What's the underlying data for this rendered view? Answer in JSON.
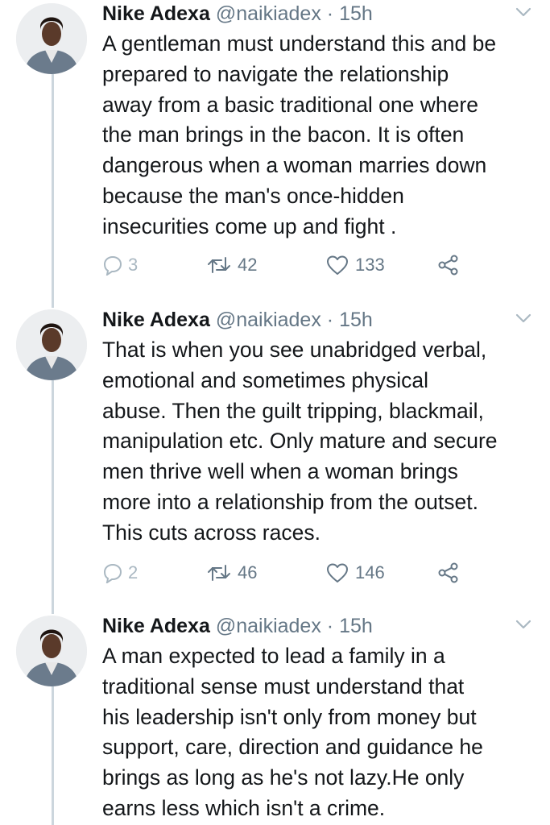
{
  "tweets": [
    {
      "name": "Nike Adexa",
      "handle": "@naikiadex",
      "separator": "·",
      "time": "15h",
      "lines": [
        "A gentleman must understand this and be",
        "prepared to navigate the relationship",
        "away from a basic traditional one where",
        "the man brings in the bacon. It is often",
        "dangerous when a woman marries down",
        "because the man's once-hidden",
        "insecurities come up and fight ."
      ],
      "replies": "3",
      "retweets": "42",
      "likes": "133"
    },
    {
      "name": "Nike Adexa",
      "handle": "@naikiadex",
      "separator": "·",
      "time": "15h",
      "lines": [
        "That is when you see unabridged verbal,",
        "emotional and sometimes physical",
        "abuse. Then the guilt tripping, blackmail,",
        "manipulation etc. Only mature and secure",
        "men thrive well when a woman brings",
        "more into a relationship from the outset.",
        "This cuts across races."
      ],
      "replies": "2",
      "retweets": "46",
      "likes": "146"
    },
    {
      "name": "Nike Adexa",
      "handle": "@naikiadex",
      "separator": "·",
      "time": "15h",
      "lines": [
        "A man expected to lead a family in a",
        "traditional sense must understand that",
        "his leadership isn't only from money but",
        "support, care, direction and guidance he",
        "brings as long as he's not lazy.He only",
        "earns less which isn't a crime."
      ]
    }
  ],
  "icons": {
    "reply": "reply-icon",
    "retweet": "retweet-icon",
    "like": "heart-icon",
    "share": "share-icon",
    "menu": "chevron-down-icon"
  },
  "colors": {
    "text": "#14171a",
    "muted": "#657786",
    "thread_line": "#ccd6dd"
  }
}
